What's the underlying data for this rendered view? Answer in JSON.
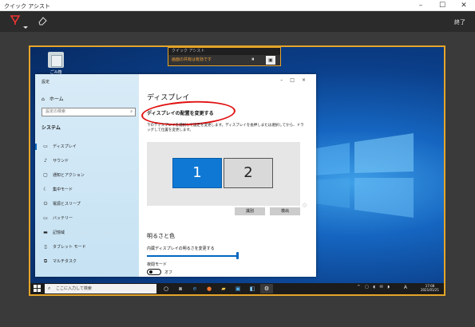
{
  "app": {
    "title": "クイック アシスト",
    "end_label": "終了"
  },
  "window_controls": {
    "minimize": "–",
    "maximize": "☐",
    "close": "✕"
  },
  "toolbar": {
    "annotate_icon": "pen-icon",
    "eraser_icon": "eraser-icon"
  },
  "desktop": {
    "recycle_bin_label": "ごみ箱"
  },
  "share_bar": {
    "title": "クイック アシスト",
    "message": "画面の共有は有効です",
    "pause_glyph": "⏸",
    "colors": {
      "border": "#e5a52a",
      "message": "#f1a43a"
    }
  },
  "settings": {
    "window_title": "設定",
    "controls": "–□×",
    "home_label": "ホーム",
    "search_placeholder": "設定の検索",
    "section_label": "システム",
    "nav_items": [
      {
        "icon": "monitor-icon",
        "label": "ディスプレイ",
        "selected": true
      },
      {
        "icon": "speaker-icon",
        "label": "サウンド"
      },
      {
        "icon": "notification-icon",
        "label": "通知とアクション"
      },
      {
        "icon": "focus-assist-icon",
        "label": "集中モード"
      },
      {
        "icon": "power-icon",
        "label": "電源とスリープ"
      },
      {
        "icon": "battery-icon",
        "label": "バッテリー"
      },
      {
        "icon": "storage-icon",
        "label": "記憶域"
      },
      {
        "icon": "tablet-icon",
        "label": "タブレット モード"
      },
      {
        "icon": "multitask-icon",
        "label": "マルチタスク"
      }
    ],
    "main": {
      "page_title": "ディスプレイ",
      "subheading": "ディスプレイの配置を変更する",
      "description": "下のディスプレイを選択して設定を変更します。ディスプレイを長押しまたは選択してから、ドラッグして位置を変更します。",
      "monitors": [
        "1",
        "2"
      ],
      "identify_label": "識別",
      "detect_label": "検出",
      "brightness_section": "明るさと色",
      "brightness_label": "内蔵ディスプレイの明るさを変更する",
      "brightness_level": 1.0,
      "night_mode_label": "夜間モード",
      "night_mode_state": "オフ"
    }
  },
  "taskbar": {
    "search_placeholder": "ここに入力して検索",
    "icons": [
      "cortana-icon",
      "task-view-icon",
      "edge-icon",
      "firefox-icon",
      "file-explorer-icon",
      "store-icon",
      "quick-assist-icon",
      "settings-gear-icon"
    ],
    "ime": "A",
    "time": "17:08",
    "date": "2021/01/21"
  },
  "colors": {
    "accent": "#0067c0",
    "annotation_red": "#e01010",
    "frame_orange": "#e5a52a"
  }
}
